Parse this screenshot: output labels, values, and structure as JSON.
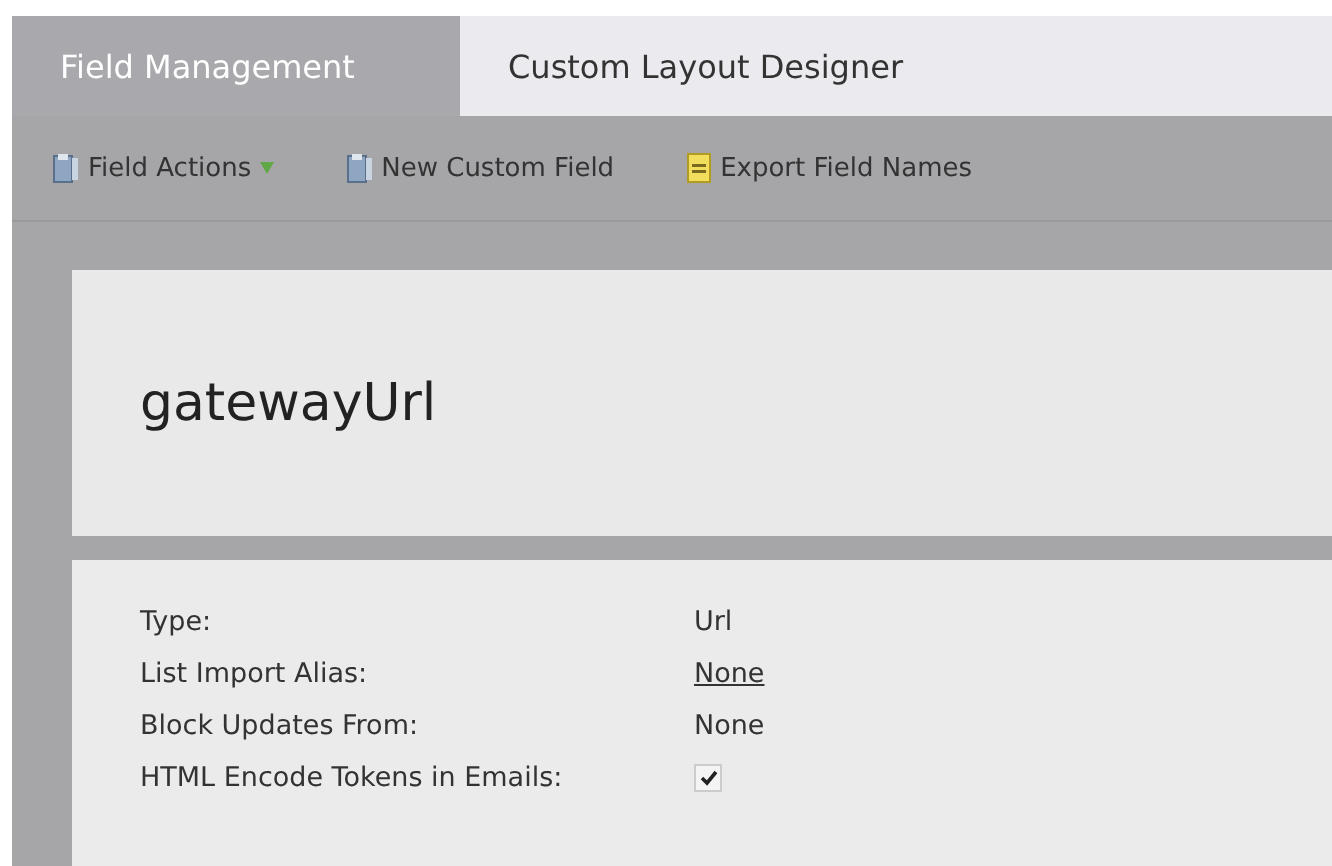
{
  "tabs": [
    {
      "label": "Field Management",
      "selected": true
    },
    {
      "label": "Custom Layout Designer",
      "selected": false
    }
  ],
  "toolbar": [
    {
      "label": "Field Actions",
      "dropdown": true
    },
    {
      "label": "New Custom Field",
      "dropdown": false
    },
    {
      "label": "Export Field Names",
      "dropdown": false
    }
  ],
  "field": {
    "title": "gatewayUrl",
    "properties": [
      {
        "label": "Type:",
        "kind": "text",
        "value": "Url"
      },
      {
        "label": "List Import Alias:",
        "kind": "link",
        "value": "None"
      },
      {
        "label": "Block Updates From:",
        "kind": "text",
        "value": "None"
      },
      {
        "label": "HTML Encode Tokens in Emails:",
        "kind": "checkbox",
        "checked": true
      }
    ]
  }
}
